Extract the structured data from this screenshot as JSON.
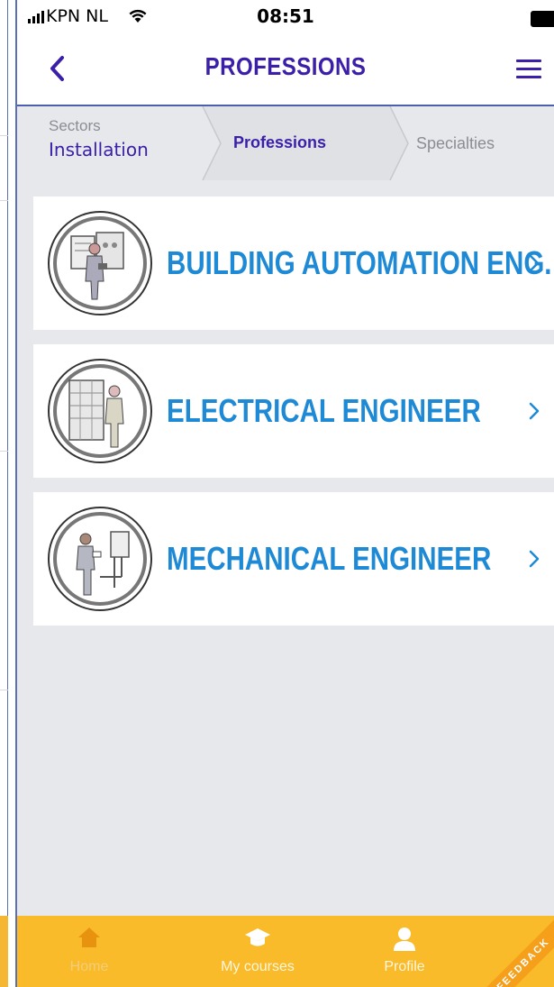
{
  "status_bar": {
    "carrier": "KPN NL",
    "time": "08:51",
    "icons": [
      "signal-icon",
      "wifi-icon",
      "battery-icon"
    ]
  },
  "nav": {
    "title": "PROFESSIONS",
    "back_icon": "chevron-left-icon",
    "menu_icon": "hamburger-menu-icon"
  },
  "breadcrumb": {
    "sectors_label": "Sectors",
    "sectors_value": "Installation",
    "professions_label": "Professions",
    "specialties_label": "Specialties"
  },
  "professions": [
    {
      "label": "BUILDING AUTOMATION ENG.",
      "icon": "building-automation-engineer-illustration"
    },
    {
      "label": "ELECTRICAL ENGINEER",
      "icon": "electrical-engineer-illustration"
    },
    {
      "label": "MECHANICAL ENGINEER",
      "icon": "mechanical-engineer-illustration"
    }
  ],
  "tabbar": {
    "home": "Home",
    "courses": "My courses",
    "profile": "Profile",
    "feedback": "FEEDBACK"
  },
  "colors": {
    "accent": "#3b1fa8",
    "link": "#1e8ad6",
    "tabbar": "#f9bb2a",
    "background": "#e6e8eb"
  }
}
